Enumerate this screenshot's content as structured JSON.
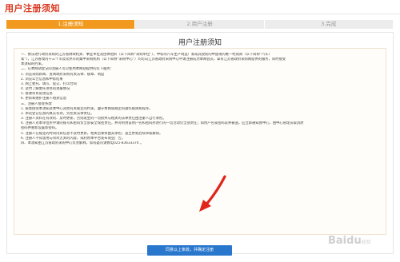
{
  "header": {
    "title": "用户注册须知"
  },
  "steps": [
    {
      "label": "1.注册须知",
      "active": true
    },
    {
      "label": "2.用户注册",
      "active": false
    },
    {
      "label": "3.完成",
      "active": false
    }
  ],
  "notice": {
    "title": "用户注册须知",
    "lines": [
      "一、依法进行政府采购的江苏省财政机关、事业单位及团体组织（以下简称“采购单位”），中标的汽车生产制造厂家或其授权的中国境内唯一经销商（以下简称“汽车厂",
      "家”），江苏省境内十三个市及常熟市的集中采购机构（以下简称“采购中心”）均可向江苏省政府采购中心申请注册成为本网会员，拿有江苏省政府采购网提供的服务，同时接受",
      "本须知的约束。",
      "二、在本网站登记的注册人可以使用本网站提供的以下服务：",
      "1. 浏览采购新闻、查阅政府采购有关法律、规章、制度",
      "2. 浏览公告信息和中标结果",
      "3. 网上委托、填写、提交、打印合同",
      "4. 及时了解委托项目的进展情况",
      "5. 接收项目反馈信息",
      "6. 更新和维护注册人相关信息",
      "三、注册人接受条款",
      "1. 愿意接受本须知及本中心其他有关规定的约束，遵守本网站规定的操作规则和程序。",
      "2. 承诺登记信息的真实有效，负担关法律责任。",
      "3. 注册人资料在有效的、及时更新，否则发生的一切损失与相关的法律责任由注册人自行承担。",
      "4. 注册人对本单位所申请的账号和密码负全部安全保密责任，并对利用该用户名和密码所进行的一切活动负全部责任；如用户名或密码丢失被盗，应立即通知我中心，由中心管理员取消原",
      "密码并重新设置新密码。",
      "5. 注册人在规定的时间内如信息不及时更新，相关后果将由其承担，直至更新后续审核解除。",
      "6. 注册人不得滥用与项目无关的内容，或利用本平台发布商业广告。",
      "四、本须知由江苏省政府采购中心负责解释。如有疑问请致电025-83633374 。"
    ]
  },
  "agree_button": {
    "label": "同意以上条款，并确定注册"
  },
  "watermark": {
    "text": "Baidu",
    "subtext": "经验"
  },
  "colors": {
    "accent_red": "#d9351b",
    "step_active": "#f19a1f",
    "button_blue": "#2877cd",
    "arrow_red": "#e0251b"
  }
}
